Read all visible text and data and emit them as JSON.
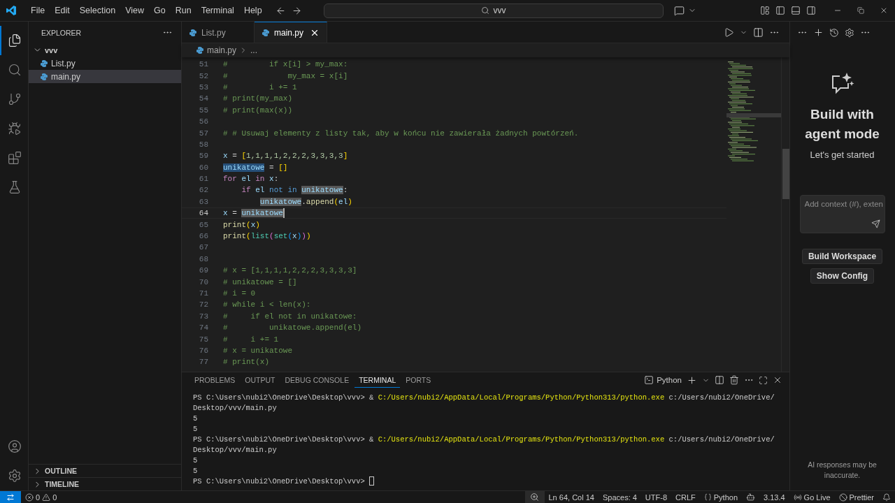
{
  "title_bar": {
    "menu": [
      "File",
      "Edit",
      "Selection",
      "View",
      "Go",
      "Run",
      "Terminal",
      "Help"
    ],
    "search": {
      "value": "vvv"
    }
  },
  "activity_bar": {
    "items": [
      {
        "kind": "explorer",
        "selected": true
      },
      {
        "kind": "search",
        "selected": false
      },
      {
        "kind": "source-control",
        "selected": false
      },
      {
        "kind": "run",
        "selected": false
      },
      {
        "kind": "extensions",
        "selected": false
      },
      {
        "kind": "testing",
        "selected": false
      }
    ]
  },
  "sidebar": {
    "title": "EXPLORER",
    "tree": [
      {
        "label": "vvv",
        "expanded": true,
        "children": [
          {
            "label": "List.py",
            "selected": false
          },
          {
            "label": "main.py",
            "selected": true
          }
        ]
      }
    ],
    "sections": [
      {
        "label": "OUTLINE",
        "expanded": false
      },
      {
        "label": "TIMELINE",
        "expanded": false
      }
    ]
  },
  "editor": {
    "tabs": [
      {
        "label": "List.py",
        "selected": false
      },
      {
        "label": "main.py",
        "selected": true
      }
    ],
    "breadcrumb": [
      "main.py",
      "..."
    ],
    "lines": [
      {
        "number": "51",
        "current": false,
        "tokens": [
          {
            "text": "#         if x[i] > my_max:",
            "kind": "comment"
          }
        ]
      },
      {
        "number": "52",
        "current": false,
        "tokens": [
          {
            "text": "#             my_max = x[i]",
            "kind": "comment"
          }
        ]
      },
      {
        "number": "53",
        "current": false,
        "tokens": [
          {
            "text": "#         i += 1",
            "kind": "comment"
          }
        ]
      },
      {
        "number": "54",
        "current": false,
        "tokens": [
          {
            "text": "# print(my_max)",
            "kind": "comment"
          }
        ]
      },
      {
        "number": "55",
        "current": false,
        "tokens": [
          {
            "text": "# print(max(x))",
            "kind": "comment"
          }
        ]
      },
      {
        "number": "56",
        "current": false
      },
      {
        "number": "57",
        "current": false,
        "tokens": [
          {
            "text": "# # Usuwaj elementy z listy tak, aby w końcu nie zawierała żadnych powtórzeń.",
            "kind": "comment"
          }
        ]
      },
      {
        "number": "58",
        "current": false
      },
      {
        "number": "59",
        "current": false,
        "tokens": [
          {
            "text": "x",
            "kind": "variable"
          },
          {
            "text": " = ",
            "kind": "plain"
          },
          {
            "text": "[",
            "kind": "bracket1"
          },
          {
            "text": "1,1,1,1,2,2,2,3,3,3,3",
            "kind": "number"
          },
          {
            "text": "]",
            "kind": "bracket1"
          }
        ]
      },
      {
        "number": "60",
        "current": false,
        "tokens": [
          {
            "text": "unikatowe",
            "kind": "variable",
            "selected": true
          },
          {
            "text": " = ",
            "kind": "plain"
          },
          {
            "text": "[]",
            "kind": "bracket1"
          }
        ]
      },
      {
        "number": "61",
        "current": false,
        "tokens": [
          {
            "text": "for ",
            "kind": "control"
          },
          {
            "text": "el ",
            "kind": "variable"
          },
          {
            "text": "in ",
            "kind": "control"
          },
          {
            "text": "x",
            "kind": "variable"
          },
          {
            "text": ":",
            "kind": "plain"
          }
        ]
      },
      {
        "number": "62",
        "current": false,
        "tokens": [
          {
            "text": "    if ",
            "kind": "control"
          },
          {
            "text": "el ",
            "kind": "variable"
          },
          {
            "text": "not in ",
            "kind": "keyword"
          },
          {
            "text": "unikatowe",
            "kind": "variable",
            "occurrence": true
          },
          {
            "text": ":",
            "kind": "plain"
          }
        ]
      },
      {
        "number": "63",
        "current": false,
        "tokens": [
          {
            "text": "        unikatowe",
            "kind": "variable",
            "occurrence": true
          },
          {
            "text": ".",
            "kind": "plain"
          },
          {
            "text": "append",
            "kind": "function"
          },
          {
            "text": "(",
            "kind": "bracket1"
          },
          {
            "text": "el",
            "kind": "variable"
          },
          {
            "text": ")",
            "kind": "bracket1"
          }
        ]
      },
      {
        "number": "64",
        "current": true,
        "tokens": [
          {
            "text": "x",
            "kind": "variable"
          },
          {
            "text": " = ",
            "kind": "plain"
          },
          {
            "text": "unikatowe",
            "kind": "variable",
            "occurrence": true
          }
        ]
      },
      {
        "number": "65",
        "current": false,
        "tokens": [
          {
            "text": "print",
            "kind": "function"
          },
          {
            "text": "(",
            "kind": "bracket1"
          },
          {
            "text": "x",
            "kind": "variable"
          },
          {
            "text": ")",
            "kind": "bracket1"
          }
        ]
      },
      {
        "number": "66",
        "current": false,
        "tokens": [
          {
            "text": "print",
            "kind": "function"
          },
          {
            "text": "(",
            "kind": "bracket1"
          },
          {
            "text": "list",
            "kind": "class"
          },
          {
            "text": "(",
            "kind": "bracket2"
          },
          {
            "text": "set",
            "kind": "class"
          },
          {
            "text": "(",
            "kind": "bracket3"
          },
          {
            "text": "x",
            "kind": "variable"
          },
          {
            "text": ")",
            "kind": "bracket3"
          },
          {
            "text": ")",
            "kind": "bracket2"
          },
          {
            "text": ")",
            "kind": "bracket1"
          }
        ]
      },
      {
        "number": "67",
        "current": false
      },
      {
        "number": "68",
        "current": false
      },
      {
        "number": "69",
        "current": false,
        "tokens": [
          {
            "text": "# x = [1,1,1,1,2,2,2,3,3,3,3]",
            "kind": "comment"
          }
        ]
      },
      {
        "number": "70",
        "current": false,
        "tokens": [
          {
            "text": "# unikatowe = []",
            "kind": "comment"
          }
        ]
      },
      {
        "number": "71",
        "current": false,
        "tokens": [
          {
            "text": "# i = 0",
            "kind": "comment"
          }
        ]
      },
      {
        "number": "72",
        "current": false,
        "tokens": [
          {
            "text": "# while i < len(x):",
            "kind": "comment"
          }
        ]
      },
      {
        "number": "73",
        "current": false,
        "tokens": [
          {
            "text": "#     if el not in unikatowe:",
            "kind": "comment"
          }
        ]
      },
      {
        "number": "74",
        "current": false,
        "tokens": [
          {
            "text": "#         unikatowe.append(el)",
            "kind": "comment"
          }
        ]
      },
      {
        "number": "75",
        "current": false,
        "tokens": [
          {
            "text": "#     i += 1",
            "kind": "comment"
          }
        ]
      },
      {
        "number": "76",
        "current": false,
        "tokens": [
          {
            "text": "# x = unikatowe",
            "kind": "comment"
          }
        ]
      },
      {
        "number": "77",
        "current": false,
        "tokens": [
          {
            "text": "# print(x)",
            "kind": "comment"
          }
        ]
      }
    ]
  },
  "panel": {
    "tabs": [
      {
        "label": "PROBLEMS",
        "selected": false
      },
      {
        "label": "OUTPUT",
        "selected": false
      },
      {
        "label": "DEBUG CONSOLE",
        "selected": false
      },
      {
        "label": "TERMINAL",
        "selected": true
      },
      {
        "label": "PORTS",
        "selected": false
      }
    ],
    "terminal_profile": "Python",
    "terminal": {
      "cursor": true,
      "lines": [
        {
          "segments": [
            {
              "text": "PS C:\\Users\\nubi2\\OneDrive\\Desktop\\vvv> & ",
              "kind": "plain"
            },
            {
              "text": "C:/Users/nubi2/AppData/Local/Programs/Python/Python313/python.exe",
              "kind": "path"
            },
            {
              "text": " c:/Users/nubi2/OneDrive/",
              "kind": "plain"
            }
          ]
        },
        {
          "segments": [
            {
              "text": "Desktop/vvv/main.py",
              "kind": "plain"
            }
          ]
        },
        {
          "segments": [
            {
              "text": "5",
              "kind": "plain"
            }
          ]
        },
        {
          "segments": [
            {
              "text": "5",
              "kind": "plain"
            }
          ]
        },
        {
          "segments": [
            {
              "text": "PS C:\\Users\\nubi2\\OneDrive\\Desktop\\vvv> & ",
              "kind": "plain"
            },
            {
              "text": "C:/Users/nubi2/AppData/Local/Programs/Python/Python313/python.exe",
              "kind": "path"
            },
            {
              "text": " c:/Users/nubi2/OneDrive/",
              "kind": "plain"
            }
          ]
        },
        {
          "segments": [
            {
              "text": "Desktop/vvv/main.py",
              "kind": "plain"
            }
          ]
        },
        {
          "segments": [
            {
              "text": "5",
              "kind": "plain"
            }
          ]
        },
        {
          "segments": [
            {
              "text": "5",
              "kind": "plain"
            }
          ]
        },
        {
          "segments": [
            {
              "text": "PS C:\\Users\\nubi2\\OneDrive\\Desktop\\vvv> ",
              "kind": "plain"
            }
          ]
        }
      ]
    }
  },
  "chat": {
    "heading": "Build with agent mode",
    "subheading": "Let's get started",
    "input": {
      "placeholder": "Add context (#), exten"
    },
    "buttons": [
      "Build Workspace",
      "Show Config"
    ],
    "disclaimer": "AI responses may be inaccurate."
  },
  "status_bar": {
    "errors": "0",
    "warnings": "0",
    "items": [
      {
        "kind": "zoom"
      },
      {
        "kind": "text",
        "text": "Ln 64, Col 14"
      },
      {
        "kind": "text",
        "text": "Spaces: 4"
      },
      {
        "kind": "text",
        "text": "UTF-8"
      },
      {
        "kind": "text",
        "text": "CRLF"
      },
      {
        "kind": "language",
        "text": "Python"
      },
      {
        "kind": "copilot"
      },
      {
        "kind": "text",
        "text": "3.13.4"
      },
      {
        "kind": "golive",
        "text": "Go Live"
      },
      {
        "kind": "prettier",
        "text": "Prettier"
      },
      {
        "kind": "bell"
      }
    ]
  }
}
